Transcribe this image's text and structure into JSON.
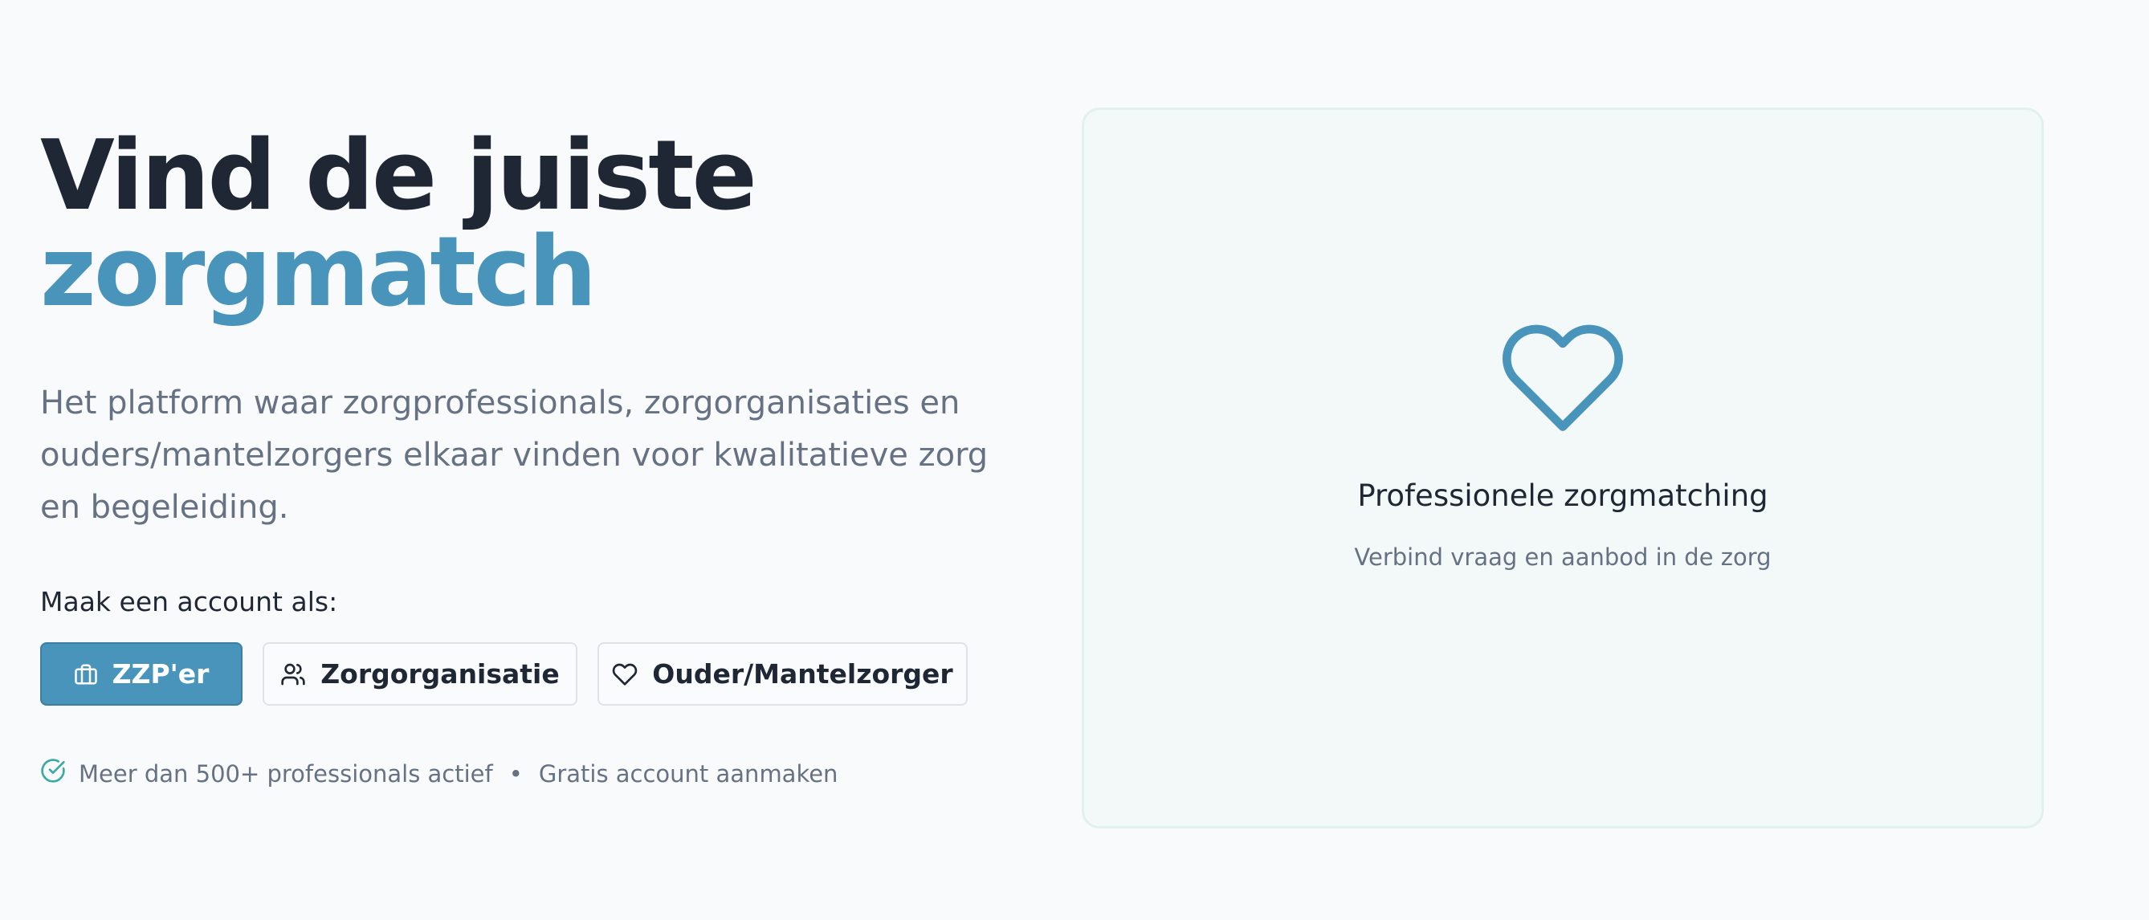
{
  "hero": {
    "title_line1": "Vind de juiste",
    "title_line2": "zorgmatch",
    "subtitle": "Het platform waar zorgprofessionals, zorgorganisaties en ouders/mantelzorgers elkaar vinden voor kwalitatieve zorg en begeleiding.",
    "account_label": "Maak een account als:"
  },
  "roles": [
    {
      "label": "ZZP'er",
      "icon": "briefcase-icon",
      "active": true
    },
    {
      "label": "Zorgorganisatie",
      "icon": "users-icon",
      "active": false
    },
    {
      "label": "Ouder/Mantelzorger",
      "icon": "heart-icon",
      "active": false
    }
  ],
  "trust": {
    "icon": "check-circle-icon",
    "text_left": "Meer dan 500+ professionals actief",
    "separator": "•",
    "text_right": "Gratis account aanmaken"
  },
  "card": {
    "icon": "heart-icon",
    "title": "Professionele zorgmatching",
    "subtitle": "Verbind vraag en aanbod in de zorg"
  },
  "colors": {
    "accent": "#4894bb",
    "heading": "#1f2735",
    "muted": "#667283",
    "background": "#f9fafb",
    "card_bg": "#f3f8f8",
    "card_border": "#e2f0ee",
    "check": "#3ba9a5"
  }
}
